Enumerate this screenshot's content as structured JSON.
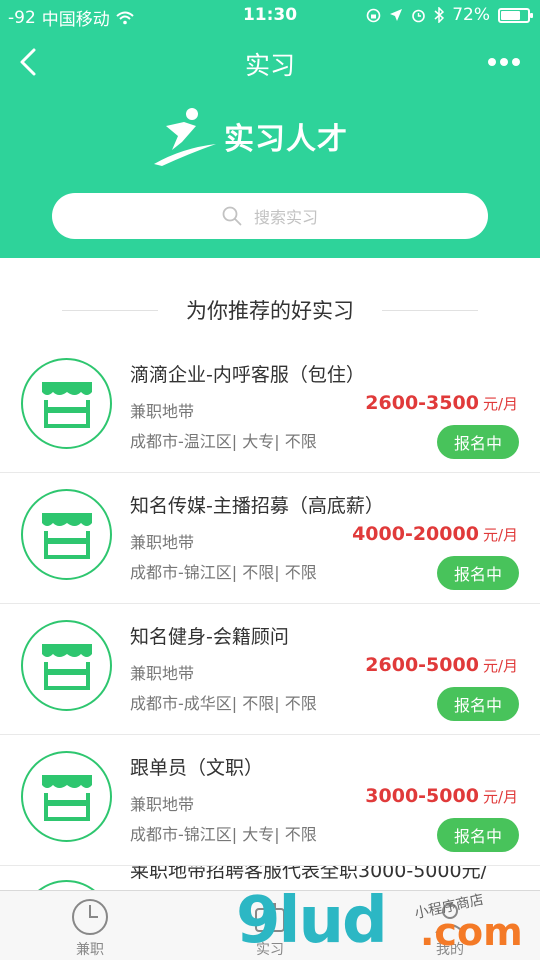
{
  "status_bar": {
    "signal": "-92",
    "carrier": "中国移动",
    "time": "11:30",
    "battery": "72%",
    "battery_level": 0.72
  },
  "nav": {
    "title": "实习"
  },
  "logo": {
    "text": "实习人才"
  },
  "search": {
    "placeholder": "搜索实习"
  },
  "section": {
    "title": "为你推荐的好实习"
  },
  "items": [
    {
      "title": "滴滴企业-内呼客服（包住）",
      "company": "兼职地带",
      "meta": "成都市-温江区| 大专| 不限",
      "salary": "2600-3500",
      "unit": "元/月",
      "status": "报名中"
    },
    {
      "title": "知名传媒-主播招募（高底薪）",
      "company": "兼职地带",
      "meta": "成都市-锦江区| 不限| 不限",
      "salary": "4000-20000",
      "unit": "元/月",
      "status": "报名中"
    },
    {
      "title": "知名健身-会籍顾问",
      "company": "兼职地带",
      "meta": "成都市-成华区| 不限| 不限",
      "salary": "2600-5000",
      "unit": "元/月",
      "status": "报名中"
    },
    {
      "title": "跟单员（文职）",
      "company": "兼职地带",
      "meta": "成都市-锦江区| 大专| 不限",
      "salary": "3000-5000",
      "unit": "元/月",
      "status": "报名中"
    }
  ],
  "partial_item": {
    "title": "莱职地带招聘客服代表全职3000-5000元/"
  },
  "tabs": [
    {
      "label": "兼职",
      "icon": "clock-icon"
    },
    {
      "label": "实习",
      "icon": "briefcase-icon"
    },
    {
      "label": "我的",
      "icon": "person-icon"
    }
  ],
  "watermark": {
    "main": "9lud",
    "com": ".com",
    "hand": "小程序商店"
  },
  "colors": {
    "header_green": "#2ed39a",
    "salary_red": "#e03a3a",
    "button_green": "#48c35b"
  }
}
